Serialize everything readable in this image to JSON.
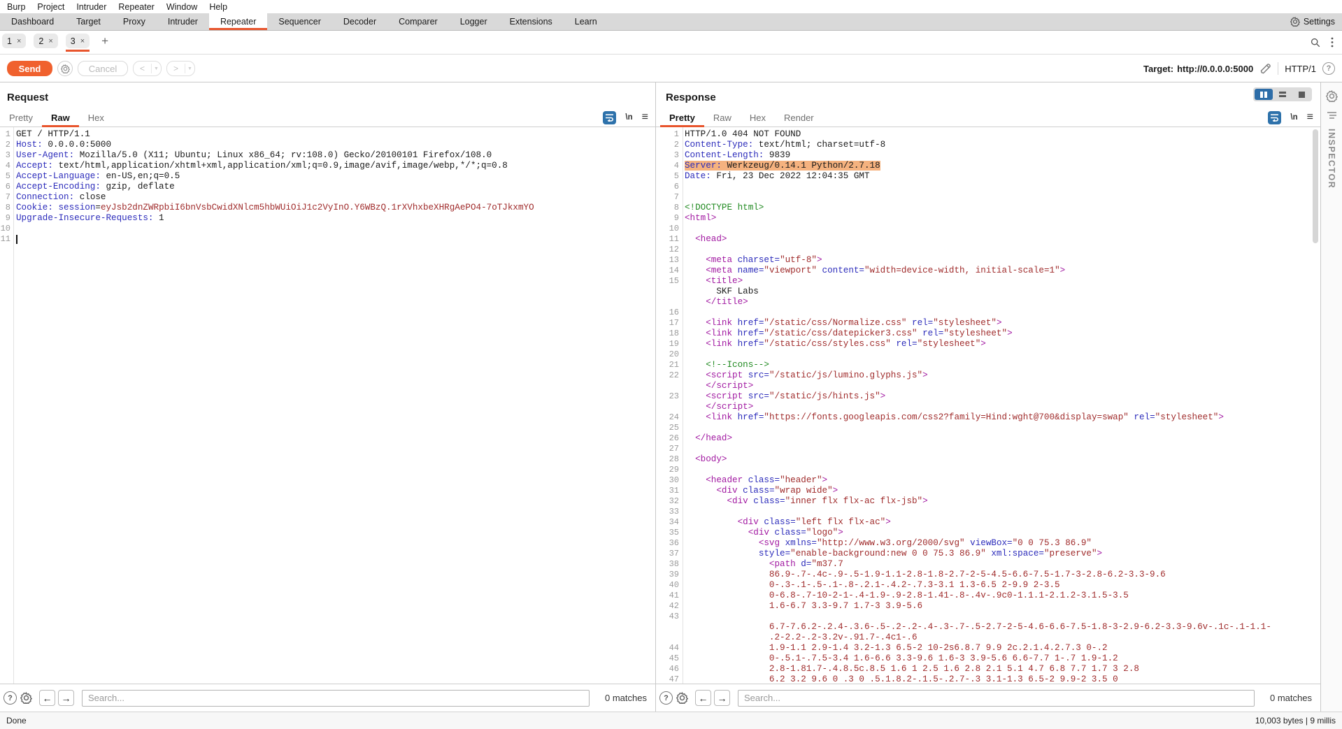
{
  "menu": {
    "items": [
      "Burp",
      "Project",
      "Intruder",
      "Repeater",
      "Window",
      "Help"
    ]
  },
  "main_tabs": {
    "items": [
      "Dashboard",
      "Target",
      "Proxy",
      "Intruder",
      "Repeater",
      "Sequencer",
      "Decoder",
      "Comparer",
      "Logger",
      "Extensions",
      "Learn"
    ],
    "selected": "Repeater",
    "settings_label": "Settings"
  },
  "repeater_tabs": {
    "items": [
      "1",
      "2",
      "3"
    ],
    "selected": "3",
    "close_glyph": "×",
    "add_label": "+"
  },
  "toolbar": {
    "send_label": "Send",
    "cancel_label": "Cancel",
    "prev_glyph": "<",
    "next_glyph": ">",
    "target_label": "Target:",
    "target_url": "http://0.0.0.0:5000",
    "http_version": "HTTP/1",
    "help_glyph": "?"
  },
  "request": {
    "title": "Request",
    "tabs": [
      "Pretty",
      "Raw",
      "Hex"
    ],
    "selected_tab": "Raw",
    "newline_glyph": "\\n",
    "lines": [
      {
        "n": "1",
        "s": [
          [
            "p",
            "GET / HTTP/1.1"
          ]
        ]
      },
      {
        "n": "2",
        "s": [
          [
            "h",
            "Host:"
          ],
          [
            "p",
            " 0.0.0.0:5000"
          ]
        ]
      },
      {
        "n": "3",
        "s": [
          [
            "h",
            "User-Agent:"
          ],
          [
            "p",
            " Mozilla/5.0 (X11; Ubuntu; Linux x86_64; rv:108.0) Gecko/20100101 Firefox/108.0"
          ]
        ]
      },
      {
        "n": "4",
        "s": [
          [
            "h",
            "Accept:"
          ],
          [
            "p",
            " text/html,application/xhtml+xml,application/xml;q=0.9,image/avif,image/webp,*/*;q=0.8"
          ]
        ]
      },
      {
        "n": "5",
        "s": [
          [
            "h",
            "Accept-Language:"
          ],
          [
            "p",
            " en-US,en;q=0.5"
          ]
        ]
      },
      {
        "n": "6",
        "s": [
          [
            "h",
            "Accept-Encoding:"
          ],
          [
            "p",
            " gzip, deflate"
          ]
        ]
      },
      {
        "n": "7",
        "s": [
          [
            "h",
            "Connection:"
          ],
          [
            "p",
            " close"
          ]
        ]
      },
      {
        "n": "8",
        "s": [
          [
            "h",
            "Cookie:"
          ],
          [
            "p",
            " "
          ],
          [
            "h",
            "session"
          ],
          [
            "p",
            "="
          ],
          [
            "r",
            "eyJsb2dnZWRpbiI6bnVsbCwidXNlcm5hbWUiOiJ1c2VyInO.Y6WBzQ.1rXVhxbeXHRgAePO4-7oTJkxmYO"
          ]
        ]
      },
      {
        "n": "9",
        "s": [
          [
            "h",
            "Upgrade-Insecure-Requests:"
          ],
          [
            "p",
            " 1"
          ]
        ]
      },
      {
        "n": "10",
        "s": []
      },
      {
        "n": "11",
        "s": [],
        "cursor": true
      }
    ]
  },
  "response": {
    "title": "Response",
    "tabs": [
      "Pretty",
      "Raw",
      "Hex",
      "Render"
    ],
    "selected_tab": "Pretty",
    "newline_glyph": "\\n",
    "highlight_color": "#f5b27f",
    "lines": [
      {
        "n": "1",
        "s": [
          [
            "p",
            "HTTP/1.0 404 NOT FOUND"
          ]
        ]
      },
      {
        "n": "2",
        "s": [
          [
            "h",
            "Content-Type:"
          ],
          [
            "p",
            " text/html; charset=utf-8"
          ]
        ]
      },
      {
        "n": "3",
        "s": [
          [
            "h",
            "Content-Length:"
          ],
          [
            "p",
            " 9839"
          ]
        ]
      },
      {
        "n": "4",
        "hl": true,
        "s": [
          [
            "h",
            "Server:"
          ],
          [
            "p",
            " Werkzeug/0.14.1 Python/2.7.18"
          ]
        ]
      },
      {
        "n": "5",
        "s": [
          [
            "h",
            "Date:"
          ],
          [
            "p",
            " Fri, 23 Dec 2022 12:04:35 GMT"
          ]
        ]
      },
      {
        "n": "6",
        "s": []
      },
      {
        "n": "7",
        "s": []
      },
      {
        "n": "8",
        "s": [
          [
            "g",
            "<!DOCTYPE html>"
          ]
        ]
      },
      {
        "n": "9",
        "s": [
          [
            "t",
            "<html>"
          ]
        ]
      },
      {
        "n": "10",
        "s": []
      },
      {
        "n": "11",
        "s": [
          [
            "p",
            "  "
          ],
          [
            "t",
            "<head>"
          ]
        ]
      },
      {
        "n": "12",
        "s": []
      },
      {
        "n": "13",
        "s": [
          [
            "p",
            "    "
          ],
          [
            "t",
            "<meta "
          ],
          [
            "a",
            "charset="
          ],
          [
            "v",
            "\"utf-8\""
          ],
          [
            "t",
            ">"
          ]
        ]
      },
      {
        "n": "14",
        "s": [
          [
            "p",
            "    "
          ],
          [
            "t",
            "<meta "
          ],
          [
            "a",
            "name="
          ],
          [
            "v",
            "\"viewport\""
          ],
          [
            "a",
            " content="
          ],
          [
            "v",
            "\"width=device-width, initial-scale=1\""
          ],
          [
            "t",
            ">"
          ]
        ]
      },
      {
        "n": "15",
        "s": [
          [
            "p",
            "    "
          ],
          [
            "t",
            "<title>"
          ]
        ]
      },
      {
        "n": "",
        "s": [
          [
            "p",
            "      SKF Labs"
          ]
        ]
      },
      {
        "n": "",
        "s": [
          [
            "p",
            "    "
          ],
          [
            "t",
            "</title>"
          ]
        ]
      },
      {
        "n": "16",
        "s": []
      },
      {
        "n": "17",
        "s": [
          [
            "p",
            "    "
          ],
          [
            "t",
            "<link "
          ],
          [
            "a",
            "href="
          ],
          [
            "v",
            "\"/static/css/Normalize.css\""
          ],
          [
            "a",
            " rel="
          ],
          [
            "v",
            "\"stylesheet\""
          ],
          [
            "t",
            ">"
          ]
        ]
      },
      {
        "n": "18",
        "s": [
          [
            "p",
            "    "
          ],
          [
            "t",
            "<link "
          ],
          [
            "a",
            "href="
          ],
          [
            "v",
            "\"/static/css/datepicker3.css\""
          ],
          [
            "a",
            " rel="
          ],
          [
            "v",
            "\"stylesheet\""
          ],
          [
            "t",
            ">"
          ]
        ]
      },
      {
        "n": "19",
        "s": [
          [
            "p",
            "    "
          ],
          [
            "t",
            "<link "
          ],
          [
            "a",
            "href="
          ],
          [
            "v",
            "\"/static/css/styles.css\""
          ],
          [
            "a",
            " rel="
          ],
          [
            "v",
            "\"stylesheet\""
          ],
          [
            "t",
            ">"
          ]
        ]
      },
      {
        "n": "20",
        "s": []
      },
      {
        "n": "21",
        "s": [
          [
            "p",
            "    "
          ],
          [
            "g",
            "<!--Icons-->"
          ]
        ]
      },
      {
        "n": "22",
        "s": [
          [
            "p",
            "    "
          ],
          [
            "t",
            "<script "
          ],
          [
            "a",
            "src="
          ],
          [
            "v",
            "\"/static/js/lumino.glyphs.js\""
          ],
          [
            "t",
            ">"
          ]
        ]
      },
      {
        "n": "",
        "s": [
          [
            "p",
            "    "
          ],
          [
            "t",
            "</script>"
          ]
        ]
      },
      {
        "n": "23",
        "s": [
          [
            "p",
            "    "
          ],
          [
            "t",
            "<script "
          ],
          [
            "a",
            "src="
          ],
          [
            "v",
            "\"/static/js/hints.js\""
          ],
          [
            "t",
            ">"
          ]
        ]
      },
      {
        "n": "",
        "s": [
          [
            "p",
            "    "
          ],
          [
            "t",
            "</script>"
          ]
        ]
      },
      {
        "n": "24",
        "s": [
          [
            "p",
            "    "
          ],
          [
            "t",
            "<link "
          ],
          [
            "a",
            "href="
          ],
          [
            "v",
            "\"https://fonts.googleapis.com/css2?family=Hind:wght@700&display=swap\""
          ],
          [
            "a",
            " rel="
          ],
          [
            "v",
            "\"stylesheet\""
          ],
          [
            "t",
            ">"
          ]
        ]
      },
      {
        "n": "25",
        "s": []
      },
      {
        "n": "26",
        "s": [
          [
            "p",
            "  "
          ],
          [
            "t",
            "</head>"
          ]
        ]
      },
      {
        "n": "27",
        "s": []
      },
      {
        "n": "28",
        "s": [
          [
            "p",
            "  "
          ],
          [
            "t",
            "<body>"
          ]
        ]
      },
      {
        "n": "29",
        "s": []
      },
      {
        "n": "30",
        "s": [
          [
            "p",
            "    "
          ],
          [
            "t",
            "<header "
          ],
          [
            "a",
            "class="
          ],
          [
            "v",
            "\"header\""
          ],
          [
            "t",
            ">"
          ]
        ]
      },
      {
        "n": "31",
        "s": [
          [
            "p",
            "      "
          ],
          [
            "t",
            "<div "
          ],
          [
            "a",
            "class="
          ],
          [
            "v",
            "\"wrap wide\""
          ],
          [
            "t",
            ">"
          ]
        ]
      },
      {
        "n": "32",
        "s": [
          [
            "p",
            "        "
          ],
          [
            "t",
            "<div "
          ],
          [
            "a",
            "class="
          ],
          [
            "v",
            "\"inner flx flx-ac flx-jsb\""
          ],
          [
            "t",
            ">"
          ]
        ]
      },
      {
        "n": "33",
        "s": []
      },
      {
        "n": "34",
        "s": [
          [
            "p",
            "          "
          ],
          [
            "t",
            "<div "
          ],
          [
            "a",
            "class="
          ],
          [
            "v",
            "\"left flx flx-ac\""
          ],
          [
            "t",
            ">"
          ]
        ]
      },
      {
        "n": "35",
        "s": [
          [
            "p",
            "            "
          ],
          [
            "t",
            "<div "
          ],
          [
            "a",
            "class="
          ],
          [
            "v",
            "\"logo\""
          ],
          [
            "t",
            ">"
          ]
        ]
      },
      {
        "n": "36",
        "s": [
          [
            "p",
            "              "
          ],
          [
            "t",
            "<svg "
          ],
          [
            "a",
            "xmlns="
          ],
          [
            "v",
            "\"http://www.w3.org/2000/svg\""
          ],
          [
            "a",
            " viewBox="
          ],
          [
            "v",
            "\"0 0 75.3 86.9\""
          ]
        ]
      },
      {
        "n": "37",
        "s": [
          [
            "p",
            "              "
          ],
          [
            "a",
            "style="
          ],
          [
            "v",
            "\"enable-background:new 0 0 75.3 86.9\""
          ],
          [
            "a",
            " xml:space="
          ],
          [
            "v",
            "\"preserve\""
          ],
          [
            "t",
            ">"
          ]
        ]
      },
      {
        "n": "38",
        "s": [
          [
            "p",
            "                "
          ],
          [
            "t",
            "<path "
          ],
          [
            "a",
            "d="
          ],
          [
            "v",
            "\"m37.7"
          ]
        ]
      },
      {
        "n": "39",
        "s": [
          [
            "p",
            "                "
          ],
          [
            "v",
            "86.9-.7-.4c-.9-.5-1.9-1.1-2.8-1.8-2.7-2-5-4.5-6.6-7.5-1.7-3-2.8-6.2-3.3-9.6"
          ]
        ]
      },
      {
        "n": "40",
        "s": [
          [
            "p",
            "                "
          ],
          [
            "v",
            "0-.3-.1-.5-.1-.8-.2.1-.4.2-.7.3-3.1 1.3-6.5 2-9.9 2-3.5"
          ]
        ]
      },
      {
        "n": "41",
        "s": [
          [
            "p",
            "                "
          ],
          [
            "v",
            "0-6.8-.7-10-2-1-.4-1.9-.9-2.8-1.41-.8-.4v-.9c0-1.1.1-2.1.2-3.1.5-3.5"
          ]
        ]
      },
      {
        "n": "42",
        "s": [
          [
            "p",
            "                "
          ],
          [
            "v",
            "1.6-6.7 3.3-9.7 1.7-3 3.9-5.6"
          ]
        ]
      },
      {
        "n": "43",
        "s": []
      },
      {
        "n": "",
        "s": [
          [
            "p",
            "                "
          ],
          [
            "v",
            "6.7-7.6.2-.2.4-.3.6-.5-.2-.2-.4-.3-.7-.5-2.7-2-5-4.6-6.6-7.5-1.8-3-2.9-6.2-3.3-9.6v-.1c-.1-1.1-"
          ]
        ]
      },
      {
        "n": "",
        "s": [
          [
            "p",
            "                "
          ],
          [
            "v",
            ".2-2.2-.2-3.2v-.91.7-.4c1-.6"
          ]
        ]
      },
      {
        "n": "44",
        "s": [
          [
            "p",
            "                "
          ],
          [
            "v",
            "1.9-1.1 2.9-1.4 3.2-1.3 6.5-2 10-2s6.8.7 9.9 2c.2.1.4.2.7.3 0-.2"
          ]
        ]
      },
      {
        "n": "45",
        "s": [
          [
            "p",
            "                "
          ],
          [
            "v",
            "0-.5.1-.7.5-3.4 1.6-6.6 3.3-9.6 1.6-3 3.9-5.6 6.6-7.7 1-.7 1.9-1.2"
          ]
        ]
      },
      {
        "n": "46",
        "s": [
          [
            "p",
            "                "
          ],
          [
            "v",
            "2.8-1.81.7-.4.8.5c.8.5 1.6 1 2.5 1.6 2.8 2.1 5.1 4.7 6.8 7.7 1.7 3 2.8"
          ]
        ]
      },
      {
        "n": "47",
        "s": [
          [
            "p",
            "                "
          ],
          [
            "v",
            "6.2 3.2 9.6 0 .3 0 .5.1.8.2-.1.5-.2.7-.3 3.1-1.3 6.5-2 9.9-2 3.5 0"
          ]
        ]
      }
    ]
  },
  "search": {
    "placeholder": "Search...",
    "matches": "0 matches"
  },
  "status": {
    "left": "Done",
    "right": "10,003 bytes | 9 millis"
  },
  "inspector": {
    "label": "INSPECTOR"
  }
}
